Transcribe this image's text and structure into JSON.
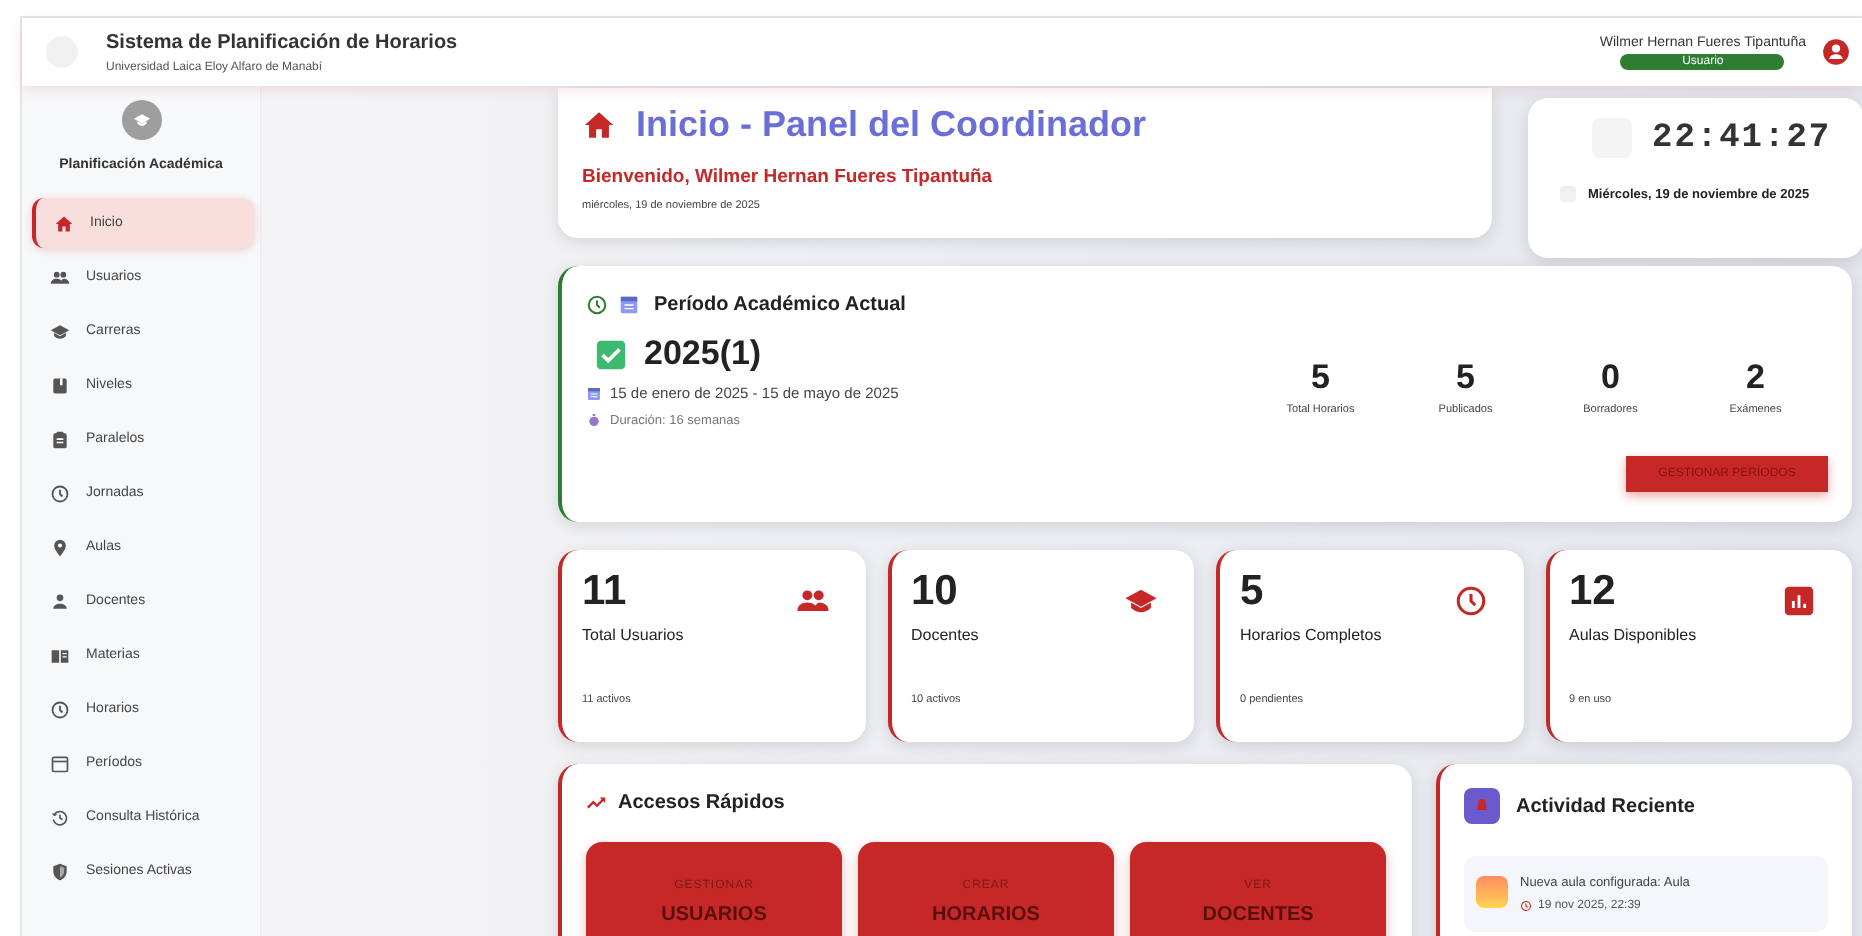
{
  "header": {
    "title": "Sistema de Planificación de Horarios",
    "subtitle": "Universidad Laica Eloy Alfaro de Manabí",
    "user": "Wilmer Hernan Fueres Tipantuña",
    "role": "Usuario"
  },
  "sidebar": {
    "title": "Planificación Académica",
    "items": [
      {
        "label": "Inicio",
        "selected": true
      },
      {
        "label": "Usuarios",
        "selected": false
      },
      {
        "label": "Carreras",
        "selected": false
      },
      {
        "label": "Niveles",
        "selected": false
      },
      {
        "label": "Paralelos",
        "selected": false
      },
      {
        "label": "Jornadas",
        "selected": false
      },
      {
        "label": "Aulas",
        "selected": false
      },
      {
        "label": "Docentes",
        "selected": false
      },
      {
        "label": "Materias",
        "selected": false
      },
      {
        "label": "Horarios",
        "selected": false
      },
      {
        "label": "Períodos",
        "selected": false
      },
      {
        "label": "Consulta Histórica",
        "selected": false
      },
      {
        "label": "Sesiones Activas",
        "selected": false
      }
    ]
  },
  "welcome": {
    "title": "Inicio - Panel del Coordinador",
    "greeting": "Bienvenido, Wilmer Hernan Fueres Tipantuña",
    "date": "miércoles, 19 de noviembre de 2025"
  },
  "clock": {
    "time": "22:41:27",
    "date": "Miércoles, 19 de noviembre de 2025"
  },
  "period": {
    "title": "Período Académico Actual",
    "name": "2025(1)",
    "range": "15 de enero de 2025 - 15 de mayo de 2025",
    "duration": "Duración: 16 semanas",
    "button": "GESTIONAR PERÍODOS",
    "stats": [
      {
        "value": "5",
        "label": "Total Horarios"
      },
      {
        "value": "5",
        "label": "Publicados"
      },
      {
        "value": "0",
        "label": "Borradores"
      },
      {
        "value": "2",
        "label": "Exámenes"
      }
    ]
  },
  "stats": [
    {
      "value": "11",
      "label": "Total Usuarios",
      "note": "11 activos"
    },
    {
      "value": "10",
      "label": "Docentes",
      "note": "10 activos"
    },
    {
      "value": "5",
      "label": "Horarios Completos",
      "note": "0 pendientes"
    },
    {
      "value": "12",
      "label": "Aulas Disponibles",
      "note": "9 en uso"
    }
  ],
  "quick_access": {
    "title": "Accesos Rápidos",
    "tiles": [
      {
        "action": "GESTIONAR",
        "target": "USUARIOS"
      },
      {
        "action": "CREAR",
        "target": "HORARIOS"
      },
      {
        "action": "VER",
        "target": "DOCENTES"
      }
    ]
  },
  "activity": {
    "title": "Actividad Reciente",
    "items": [
      {
        "text": "Nueva aula configurada: Aula",
        "time": "19 nov 2025, 22:39"
      }
    ]
  }
}
